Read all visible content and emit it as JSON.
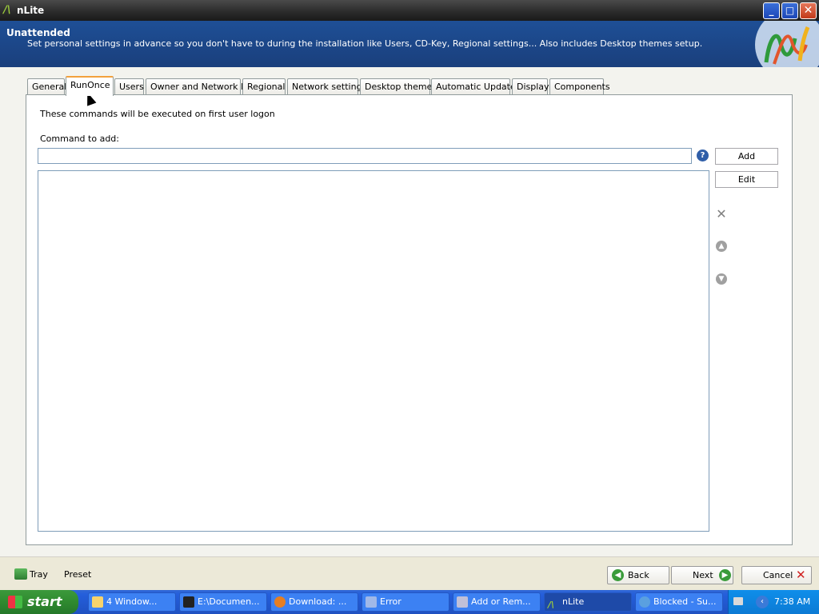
{
  "window": {
    "title": "nLite",
    "min_label": "_",
    "max_label": "□",
    "close_label": "✕"
  },
  "header": {
    "title": "Unattended",
    "description": "Set personal settings in advance so you don't have to during the installation like Users, CD-Key, Regional settings... Also includes Desktop themes setup."
  },
  "tabs": [
    {
      "label": "General"
    },
    {
      "label": "RunOnce"
    },
    {
      "label": "Users"
    },
    {
      "label": "Owner and Network ID"
    },
    {
      "label": "Regional"
    },
    {
      "label": "Network settings"
    },
    {
      "label": "Desktop themes"
    },
    {
      "label": "Automatic Updates"
    },
    {
      "label": "Display"
    },
    {
      "label": "Components"
    }
  ],
  "runonce": {
    "info": "These commands will be executed on first user logon",
    "command_label": "Command to add:",
    "command_value": "",
    "add_label": "Add",
    "edit_label": "Edit",
    "delete_glyph": "✕",
    "up_glyph": "▲",
    "down_glyph": "▼",
    "help_glyph": "?"
  },
  "footer": {
    "tray_label": "Tray",
    "preset_label": "Preset",
    "back_label": "Back",
    "next_label": "Next",
    "cancel_label": "Cancel"
  },
  "taskbar": {
    "start_label": "start",
    "tasks": [
      {
        "label": "4 Window..."
      },
      {
        "label": "E:\\Documen..."
      },
      {
        "label": "Download: ..."
      },
      {
        "label": "Error"
      },
      {
        "label": "Add or Rem..."
      },
      {
        "label": "nLite"
      },
      {
        "label": "Blocked - Su..."
      }
    ],
    "clock": "7:38 AM"
  },
  "colors": {
    "header_bg": "#1e4f96",
    "active_tab_accent": "#f3a13d",
    "taskbar": "#245edb",
    "start_green": "#2f8a2f"
  }
}
